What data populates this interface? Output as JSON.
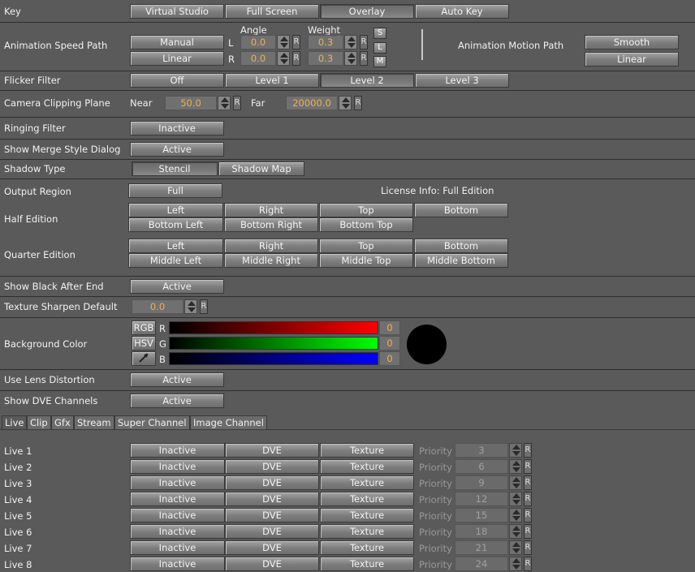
{
  "key": {
    "label": "Key",
    "options": [
      "Virtual Studio",
      "Full Screen",
      "Overlay",
      "Auto Key"
    ],
    "selected": "Overlay"
  },
  "speed_path": {
    "label": "Animation Speed Path",
    "angle_header": "Angle",
    "weight_header": "Weight",
    "manual": "Manual",
    "linear": "Linear",
    "row_l": "L",
    "row_r": "R",
    "angle_l": "0.0",
    "angle_r": "0.0",
    "weight_l": "0.3",
    "weight_r": "0.3",
    "r_btn": "R",
    "s": "S",
    "l": "L",
    "m": "M"
  },
  "motion_path": {
    "label": "Animation Motion Path",
    "smooth": "Smooth",
    "linear": "Linear"
  },
  "flicker": {
    "label": "Flicker Filter",
    "options": [
      "Off",
      "Level 1",
      "Level 2",
      "Level 3"
    ],
    "selected": "Level 2"
  },
  "clipping": {
    "label": "Camera Clipping Plane",
    "near_label": "Near",
    "near": "50.0",
    "far_label": "Far",
    "far": "20000.0",
    "r_btn": "R"
  },
  "ringing": {
    "label": "Ringing Filter",
    "value": "Inactive"
  },
  "merge": {
    "label": "Show Merge Style Dialog",
    "value": "Active"
  },
  "shadow": {
    "label": "Shadow Type",
    "options": [
      "Stencil",
      "Shadow Map"
    ],
    "selected": "Stencil"
  },
  "output_region": {
    "label": "Output Region",
    "value": "Full",
    "license": "License Info: Full Edition"
  },
  "half": {
    "label": "Half Edition",
    "row1": [
      "Left",
      "Right",
      "Top",
      "Bottom"
    ],
    "row2": [
      "Bottom Left",
      "Bottom Right",
      "Bottom Top"
    ]
  },
  "quarter": {
    "label": "Quarter Edition",
    "row1": [
      "Left",
      "Right",
      "Top",
      "Bottom"
    ],
    "row2": [
      "Middle Left",
      "Middle Right",
      "Middle Top",
      "Middle Bottom"
    ]
  },
  "black_after": {
    "label": "Show Black After End",
    "value": "Active"
  },
  "sharpen": {
    "label": "Texture Sharpen Default",
    "value": "0.0",
    "r_btn": "R"
  },
  "bg_color": {
    "label": "Background Color",
    "modes": [
      "RGB",
      "HSV"
    ],
    "channels": [
      "R",
      "G",
      "B"
    ],
    "values": [
      "0",
      "0",
      "0"
    ],
    "swatch": "#000000"
  },
  "lens": {
    "label": "Use Lens Distortion",
    "value": "Active"
  },
  "dve": {
    "label": "Show DVE Channels",
    "value": "Active"
  },
  "tabs": {
    "items": [
      "Live",
      "Clip",
      "Gfx",
      "Stream",
      "Super Channel",
      "Image Channel"
    ],
    "selected": "Live"
  },
  "live": {
    "priority_label": "Priority",
    "r_btn": "R",
    "rows": [
      {
        "name": "Live 1",
        "state": "Inactive",
        "dve": "DVE",
        "texture": "Texture",
        "priority": "3"
      },
      {
        "name": "Live 2",
        "state": "Inactive",
        "dve": "DVE",
        "texture": "Texture",
        "priority": "6"
      },
      {
        "name": "Live 3",
        "state": "Inactive",
        "dve": "DVE",
        "texture": "Texture",
        "priority": "9"
      },
      {
        "name": "Live 4",
        "state": "Inactive",
        "dve": "DVE",
        "texture": "Texture",
        "priority": "12"
      },
      {
        "name": "Live 5",
        "state": "Inactive",
        "dve": "DVE",
        "texture": "Texture",
        "priority": "15"
      },
      {
        "name": "Live 6",
        "state": "Inactive",
        "dve": "DVE",
        "texture": "Texture",
        "priority": "18"
      },
      {
        "name": "Live 7",
        "state": "Inactive",
        "dve": "DVE",
        "texture": "Texture",
        "priority": "21"
      },
      {
        "name": "Live 8",
        "state": "Inactive",
        "dve": "DVE",
        "texture": "Texture",
        "priority": "24"
      }
    ]
  }
}
